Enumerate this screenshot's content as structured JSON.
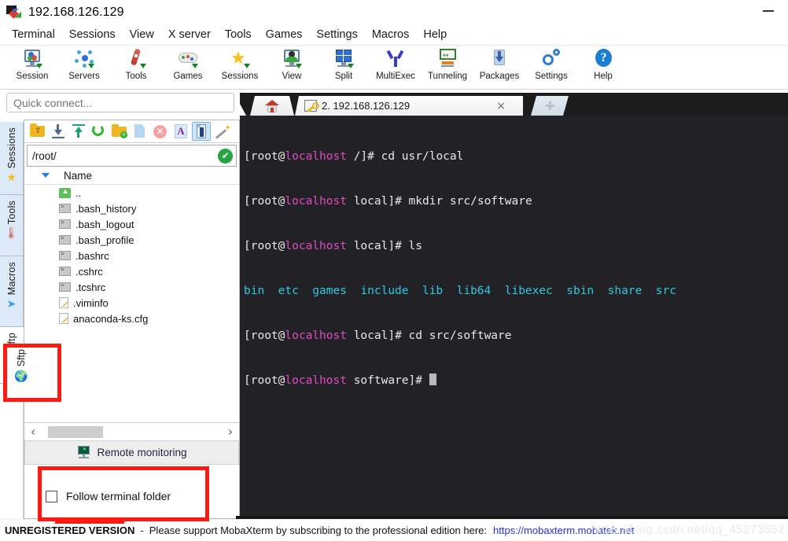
{
  "window": {
    "title": "192.168.126.129",
    "app_icon": "mobaxterm-icon",
    "minimize_label": "minimize-icon"
  },
  "menubar": [
    {
      "label": "Terminal"
    },
    {
      "label": "Sessions"
    },
    {
      "label": "View"
    },
    {
      "label": "X server"
    },
    {
      "label": "Tools"
    },
    {
      "label": "Games"
    },
    {
      "label": "Settings"
    },
    {
      "label": "Macros"
    },
    {
      "label": "Help"
    }
  ],
  "toolbar": [
    {
      "label": "Session",
      "icon": "session-icon"
    },
    {
      "label": "Servers",
      "icon": "servers-icon"
    },
    {
      "label": "Tools",
      "icon": "tools-icon"
    },
    {
      "label": "Games",
      "icon": "games-icon"
    },
    {
      "label": "Sessions",
      "icon": "sessions-star-icon"
    },
    {
      "label": "View",
      "icon": "view-icon"
    },
    {
      "label": "Split",
      "icon": "split-icon"
    },
    {
      "label": "MultiExec",
      "icon": "multiexec-icon"
    },
    {
      "label": "Tunneling",
      "icon": "tunneling-icon"
    },
    {
      "label": "Packages",
      "icon": "packages-icon"
    },
    {
      "label": "Settings",
      "icon": "settings-gear-icon"
    },
    {
      "label": "Help",
      "icon": "help-question-icon"
    }
  ],
  "quick_connect": {
    "placeholder": "Quick connect...",
    "value": ""
  },
  "side_tabs": [
    {
      "label": "Sessions",
      "icon": "star-icon",
      "selected": false
    },
    {
      "label": "Tools",
      "icon": "thermometer-icon",
      "selected": false
    },
    {
      "label": "Macros",
      "icon": "paper-plane-icon",
      "selected": false
    },
    {
      "label": "Sftp",
      "icon": "globe-icon",
      "selected": true
    }
  ],
  "collapse_button": "chevron-double-left-icon",
  "sftp": {
    "tools": [
      {
        "name": "parent-folder-icon",
        "selected": false
      },
      {
        "name": "download-icon",
        "selected": false
      },
      {
        "name": "upload-icon",
        "selected": false
      },
      {
        "name": "refresh-icon",
        "selected": false
      },
      {
        "name": "new-folder-icon",
        "selected": false
      },
      {
        "name": "new-file-icon",
        "selected": false
      },
      {
        "name": "delete-icon",
        "selected": false
      },
      {
        "name": "text-edit-icon",
        "selected": false
      },
      {
        "name": "terminal-drive-icon",
        "selected": true
      },
      {
        "name": "magic-wand-icon",
        "selected": false
      }
    ],
    "path": "/root/",
    "path_status": "ok-check-icon",
    "column_header": "Name",
    "files": [
      {
        "name": "..",
        "icon": "folder-up-icon"
      },
      {
        "name": ".bash_history",
        "icon": "shell-file-icon"
      },
      {
        "name": ".bash_logout",
        "icon": "shell-file-icon"
      },
      {
        "name": ".bash_profile",
        "icon": "shell-file-icon"
      },
      {
        "name": ".bashrc",
        "icon": "shell-file-icon"
      },
      {
        "name": ".cshrc",
        "icon": "shell-file-icon"
      },
      {
        "name": ".tcshrc",
        "icon": "shell-file-icon"
      },
      {
        "name": ".viminfo",
        "icon": "text-file-icon"
      },
      {
        "name": "anaconda-ks.cfg",
        "icon": "text-file-icon"
      }
    ],
    "scroll_left": "‹",
    "scroll_right": "›",
    "bottom_item": {
      "label": "Remote monitoring",
      "icon": "remote-monitoring-icon"
    },
    "follow_terminal_folder": {
      "label": "Follow terminal folder",
      "checked": false
    }
  },
  "tabs": {
    "home_tab": {
      "icon": "home-icon"
    },
    "session_tab": {
      "label": "2. 192.168.126.129",
      "icon": "key-icon",
      "close": "×"
    },
    "add_tab": {
      "icon": "plus-icon"
    }
  },
  "terminal": {
    "lines": [
      [
        {
          "t": "[root@",
          "c": "white"
        },
        {
          "t": "localhost",
          "c": "magenta"
        },
        {
          "t": " /]# cd usr/local",
          "c": "white"
        }
      ],
      [
        {
          "t": "[root@",
          "c": "white"
        },
        {
          "t": "localhost",
          "c": "magenta"
        },
        {
          "t": " local]# mkdir src/software",
          "c": "white"
        }
      ],
      [
        {
          "t": "[root@",
          "c": "white"
        },
        {
          "t": "localhost",
          "c": "magenta"
        },
        {
          "t": " local]# ls",
          "c": "white"
        }
      ],
      [
        {
          "t": "bin  etc  games  include  lib  lib64  libexec  sbin  share  src",
          "c": "cyan"
        }
      ],
      [
        {
          "t": "[root@",
          "c": "white"
        },
        {
          "t": "localhost",
          "c": "magenta"
        },
        {
          "t": " local]# cd src/software",
          "c": "white"
        }
      ],
      [
        {
          "t": "[root@",
          "c": "white"
        },
        {
          "t": "localhost",
          "c": "magenta"
        },
        {
          "t": " software]# ",
          "c": "white"
        },
        {
          "t": "CURSOR",
          "c": "cursor"
        }
      ]
    ],
    "colors": {
      "background": "#222226",
      "foreground": "#e8e8e8",
      "magenta": "#e24ac4",
      "cyan": "#2fc8e0"
    }
  },
  "statusbar": {
    "unregistered": "UNREGISTERED VERSION",
    "dash": "-",
    "message": "Please support MobaXterm by subscribing to the professional edition here:",
    "link": "https://mobaxterm.mobatek.net",
    "watermark": "https://blog.csdn.net/qq_45273552"
  },
  "annotations": [
    {
      "name": "sftp-tab-highlight",
      "color": "#fd1a13"
    },
    {
      "name": "follow-terminal-folder-highlight",
      "color": "#fd1a13"
    }
  ]
}
